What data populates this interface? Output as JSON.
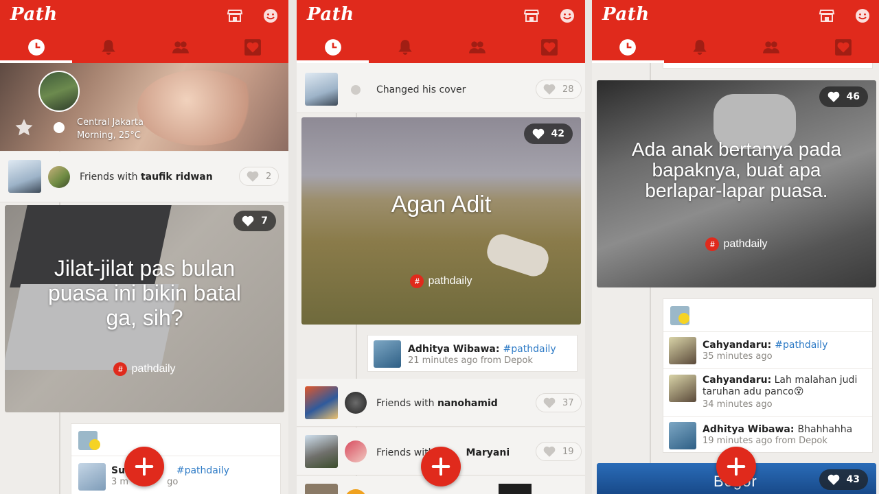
{
  "app": {
    "logo": "Path",
    "colors": {
      "brand_red": "#e02a1c",
      "tag_blue": "#2e7bc6",
      "background": "#efedea"
    },
    "tab_icons": [
      "clock-icon",
      "bell-icon",
      "friends-icon",
      "heart-icon"
    ],
    "header_icons": [
      "shop-icon",
      "smiley-icon"
    ],
    "compose_icon": "plus-icon"
  },
  "panel1": {
    "cover": {
      "location": "Central Jakarta",
      "weather": "Morning, 25°C"
    },
    "friends_row": {
      "prefix": "Friends with ",
      "name": "taufik ridwan",
      "loves": "2"
    },
    "moment": {
      "caption": "Jilat-jilat pas bulan puasa ini bikin batal ga, sih?",
      "tag": "pathdaily",
      "loves": "7"
    },
    "comment": {
      "name": "Sul",
      "tag": "#pathdaily",
      "meta": "3 m",
      "meta_tail": "go"
    }
  },
  "panel2": {
    "cover_row": {
      "text": "Changed his cover",
      "loves": "28"
    },
    "moment": {
      "caption": "Agan Adit",
      "tag": "pathdaily",
      "loves": "42"
    },
    "comment": {
      "name": "Adhitya Wibawa:",
      "tag": "#pathdaily",
      "meta": "21 minutes ago from Depok"
    },
    "friends_row_1": {
      "prefix": "Friends with ",
      "name": "nanohamid",
      "loves": "37"
    },
    "friends_row_2": {
      "prefix": "Friends with",
      "name": "Maryani",
      "loves": "19"
    }
  },
  "panel3": {
    "moment": {
      "caption": "Ada anak bertanya pada bapaknya, buat apa berlapar-lapar puasa.",
      "tag": "pathdaily",
      "loves": "46"
    },
    "comments": [
      {
        "name": "Cahyandaru:",
        "tag": "#pathdaily",
        "text": "",
        "meta": "35 minutes ago"
      },
      {
        "name": "Cahyandaru:",
        "tag": "",
        "text": "Lah malahan judi taruhan adu panco😵",
        "meta": "34 minutes ago"
      },
      {
        "name": "Adhitya Wibawa:",
        "tag": "",
        "text": "Bhahhahha",
        "meta": "19 minutes ago from Depok"
      }
    ],
    "place": {
      "name": "Bogor",
      "loves": "43"
    }
  }
}
